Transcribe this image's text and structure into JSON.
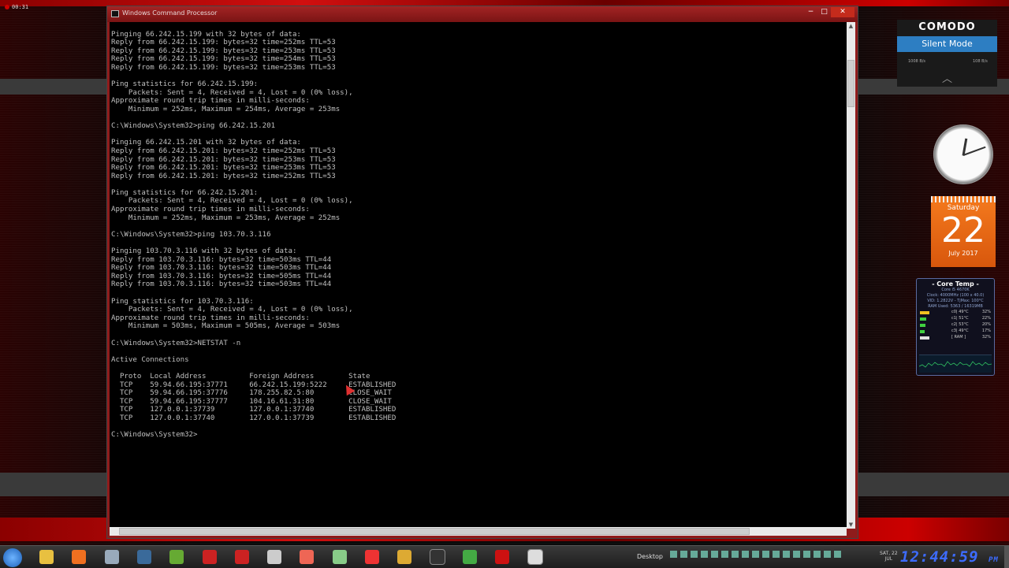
{
  "desktop_clock": "00:31",
  "window": {
    "title": "Windows Command Processor",
    "min_label": "−",
    "max_label": "□",
    "close_label": "✕",
    "console_lines": [
      "",
      "Pinging 66.242.15.199 with 32 bytes of data:",
      "Reply from 66.242.15.199: bytes=32 time=252ms TTL=53",
      "Reply from 66.242.15.199: bytes=32 time=253ms TTL=53",
      "Reply from 66.242.15.199: bytes=32 time=254ms TTL=53",
      "Reply from 66.242.15.199: bytes=32 time=253ms TTL=53",
      "",
      "Ping statistics for 66.242.15.199:",
      "    Packets: Sent = 4, Received = 4, Lost = 0 (0% loss),",
      "Approximate round trip times in milli-seconds:",
      "    Minimum = 252ms, Maximum = 254ms, Average = 253ms",
      "",
      "C:\\Windows\\System32>ping 66.242.15.201",
      "",
      "Pinging 66.242.15.201 with 32 bytes of data:",
      "Reply from 66.242.15.201: bytes=32 time=252ms TTL=53",
      "Reply from 66.242.15.201: bytes=32 time=253ms TTL=53",
      "Reply from 66.242.15.201: bytes=32 time=253ms TTL=53",
      "Reply from 66.242.15.201: bytes=32 time=252ms TTL=53",
      "",
      "Ping statistics for 66.242.15.201:",
      "    Packets: Sent = 4, Received = 4, Lost = 0 (0% loss),",
      "Approximate round trip times in milli-seconds:",
      "    Minimum = 252ms, Maximum = 253ms, Average = 252ms",
      "",
      "C:\\Windows\\System32>ping 103.70.3.116",
      "",
      "Pinging 103.70.3.116 with 32 bytes of data:",
      "Reply from 103.70.3.116: bytes=32 time=503ms TTL=44",
      "Reply from 103.70.3.116: bytes=32 time=503ms TTL=44",
      "Reply from 103.70.3.116: bytes=32 time=505ms TTL=44",
      "Reply from 103.70.3.116: bytes=32 time=503ms TTL=44",
      "",
      "Ping statistics for 103.70.3.116:",
      "    Packets: Sent = 4, Received = 4, Lost = 0 (0% loss),",
      "Approximate round trip times in milli-seconds:",
      "    Minimum = 503ms, Maximum = 505ms, Average = 503ms",
      "",
      "C:\\Windows\\System32>NETSTAT -n",
      "",
      "Active Connections",
      "",
      "  Proto  Local Address          Foreign Address        State",
      "  TCP    59.94.66.195:37771     66.242.15.199:5222     ESTABLISHED",
      "  TCP    59.94.66.195:37776     178.255.82.5:80        CLOSE_WAIT",
      "  TCP    59.94.66.195:37777     104.16.61.31:80        CLOSE_WAIT",
      "  TCP    127.0.0.1:37739        127.0.0.1:37740        ESTABLISHED",
      "  TCP    127.0.0.1:37740        127.0.0.1:37739        ESTABLISHED",
      "",
      "C:\\Windows\\System32>"
    ]
  },
  "comodo": {
    "brand": "COMODO",
    "mode": "Silent Mode",
    "rate_in": "1008 B/s",
    "rate_out": "108 B/s"
  },
  "calendar": {
    "weekday": "Saturday",
    "day": "22",
    "month_year": "July 2017"
  },
  "core_temp": {
    "title": "- Core Temp -",
    "cpu": "Core i5 4670K",
    "clock": "Clock: 4000MHz (100 x 40.0)",
    "vid": "VID: 1.2822V - TjMax: 100°C",
    "ram": "RAM Used: 5363 / 16319MB",
    "rows": [
      {
        "label": "c0| 49°C",
        "pct": "32%",
        "color": "#f0c020",
        "level": 0.32
      },
      {
        "label": "c1| 51°C",
        "pct": "22%",
        "color": "#40d040",
        "level": 0.22
      },
      {
        "label": "c2| 53°C",
        "pct": "20%",
        "color": "#40d040",
        "level": 0.2
      },
      {
        "label": "c3| 49°C",
        "pct": "17%",
        "color": "#40d040",
        "level": 0.17
      },
      {
        "label": "[ RAM ]",
        "pct": "32%",
        "color": "#e0e0e0",
        "level": 0.32
      }
    ]
  },
  "taskbar": {
    "desktop_label": "Desktop",
    "date_line1": "SAT, 22",
    "date_line2": "JUL",
    "time": "12:44:59",
    "ampm": "PM",
    "icons": [
      "windows-explorer",
      "avast",
      "file",
      "steam",
      "utorrent",
      "red-app",
      "ccleaner",
      "calendar-app",
      "firefox",
      "notepad",
      "chrome",
      "tool",
      "cmd",
      "greenshot",
      "rednet",
      "task-app"
    ]
  }
}
